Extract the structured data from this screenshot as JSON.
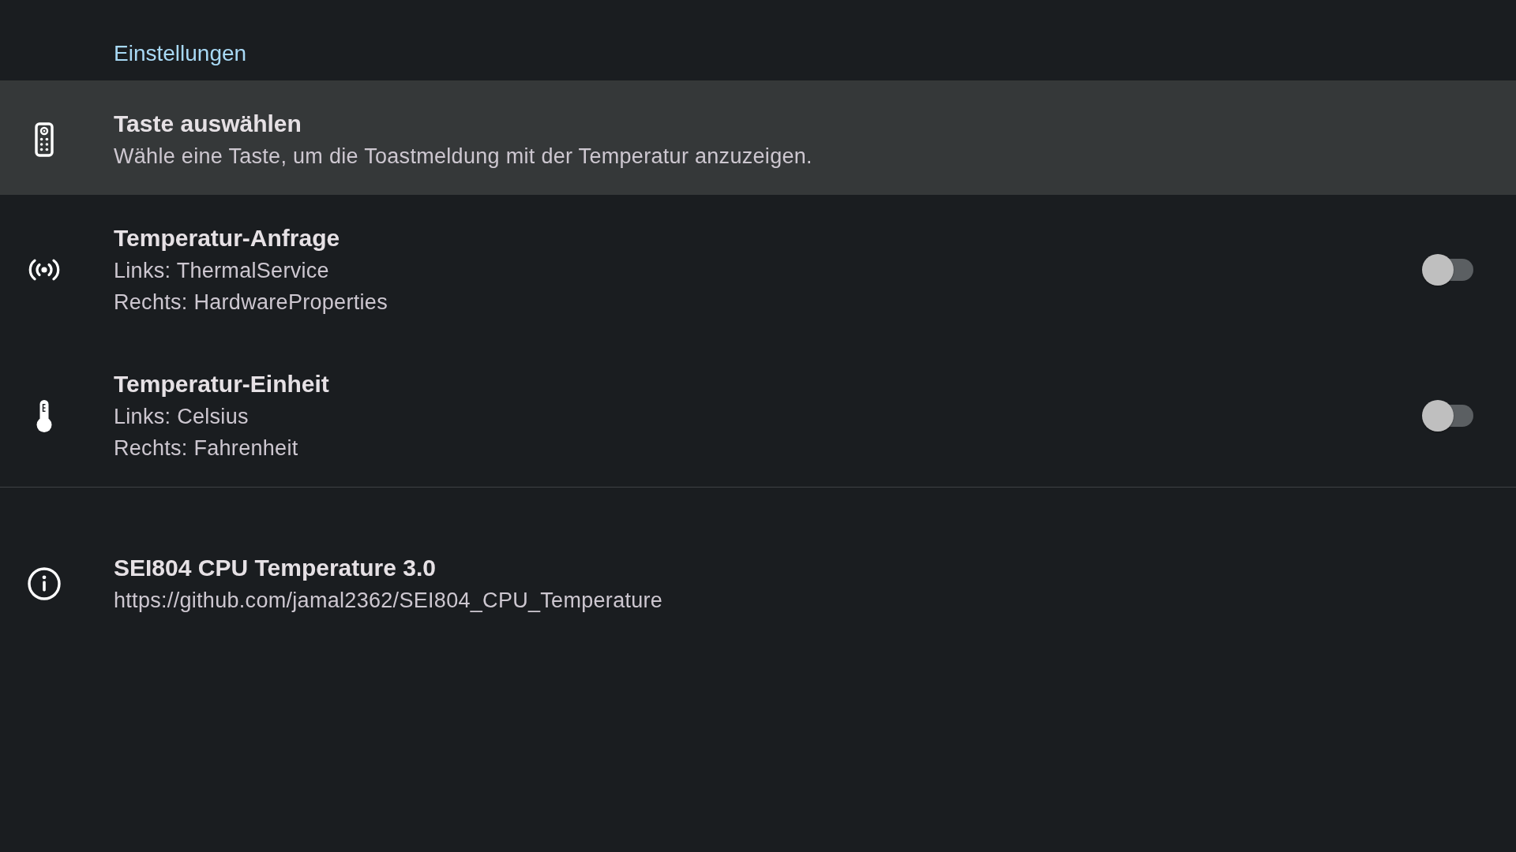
{
  "header": {
    "title": "Einstellungen"
  },
  "settings": [
    {
      "kind": "action",
      "selected": true,
      "title": "Taste auswählen",
      "lines": [
        "Wähle eine Taste, um die Toastmeldung mit der Temperatur anzuzeigen."
      ]
    },
    {
      "kind": "switch",
      "selected": false,
      "on": false,
      "title": "Temperatur-Anfrage",
      "lines": [
        "Links: ThermalService",
        "Rechts: HardwareProperties"
      ]
    },
    {
      "kind": "switch",
      "selected": false,
      "on": false,
      "title": "Temperatur-Einheit",
      "lines": [
        "Links: Celsius",
        "Rechts: Fahrenheit"
      ]
    }
  ],
  "about": {
    "title": "SEI804 CPU Temperature 3.0",
    "url": "https://github.com/jamal2362/SEI804_CPU_Temperature"
  }
}
